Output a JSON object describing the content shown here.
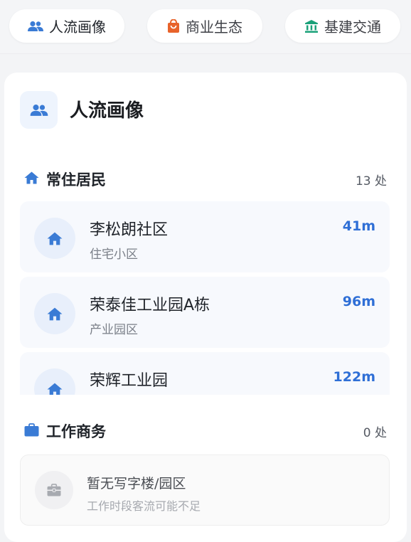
{
  "tabs": [
    {
      "label": "人流画像",
      "icon": "people-icon",
      "color": "#3a7bd5"
    },
    {
      "label": "商业生态",
      "icon": "shopping-bag-icon",
      "color": "#e8632b"
    },
    {
      "label": "基建交通",
      "icon": "bank-icon",
      "color": "#1aa179"
    }
  ],
  "card": {
    "title": "人流画像",
    "icon": "people-icon"
  },
  "residents": {
    "title": "常住居民",
    "count": "13 处",
    "icon": "home-icon",
    "items": [
      {
        "name": "李松朗社区",
        "type": "住宅小区",
        "distance": "41m"
      },
      {
        "name": "荣泰佳工业园A栋",
        "type": "产业园区",
        "distance": "96m"
      },
      {
        "name": "荣辉工业园",
        "type": "",
        "distance": "122m"
      }
    ]
  },
  "work": {
    "title": "工作商务",
    "count": "0 处",
    "icon": "briefcase-icon",
    "empty_title": "暂无写字楼/园区",
    "empty_subtitle": "工作时段客流可能不足"
  },
  "colors": {
    "accent": "#3a7bd5",
    "distance": "#2f6fd6"
  }
}
